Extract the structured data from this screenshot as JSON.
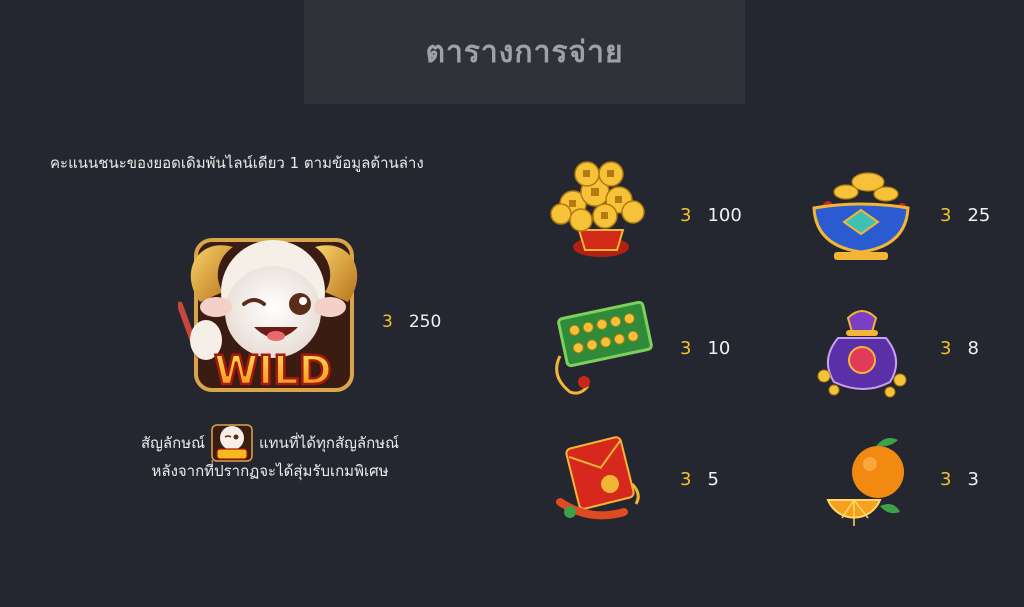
{
  "title": "ตารางการจ่าย",
  "instruction": "คะแนนชนะของยอดเดิมพันไลน์เดียว 1 ตามข้อมูลด้านล่าง",
  "wild": {
    "icon": "wild-sheep-icon",
    "label": "WILD",
    "count": "3",
    "value": "250",
    "desc_before": "สัญลักษณ์",
    "desc_after": "แทนที่ได้ทุกสัญลักษณ์",
    "desc_line2": "หลังจากที่ปรากฏจะได้สุ่มรับเกมพิเศษ"
  },
  "symbols": [
    {
      "icon": "gold-coin-tree-icon",
      "count": "3",
      "value": "100"
    },
    {
      "icon": "treasure-bowl-icon",
      "count": "3",
      "value": "25"
    },
    {
      "icon": "abacus-icon",
      "count": "3",
      "value": "10"
    },
    {
      "icon": "lucky-pouch-icon",
      "count": "3",
      "value": "8"
    },
    {
      "icon": "red-envelope-icon",
      "count": "3",
      "value": "5"
    },
    {
      "icon": "orange-icon",
      "count": "3",
      "value": "3"
    }
  ],
  "colors": {
    "background": "#24272f",
    "title_bar": "#2f3239",
    "title_text": "#9fa1a6",
    "count_text": "#f2c230",
    "value_text": "#f1f1f1"
  }
}
